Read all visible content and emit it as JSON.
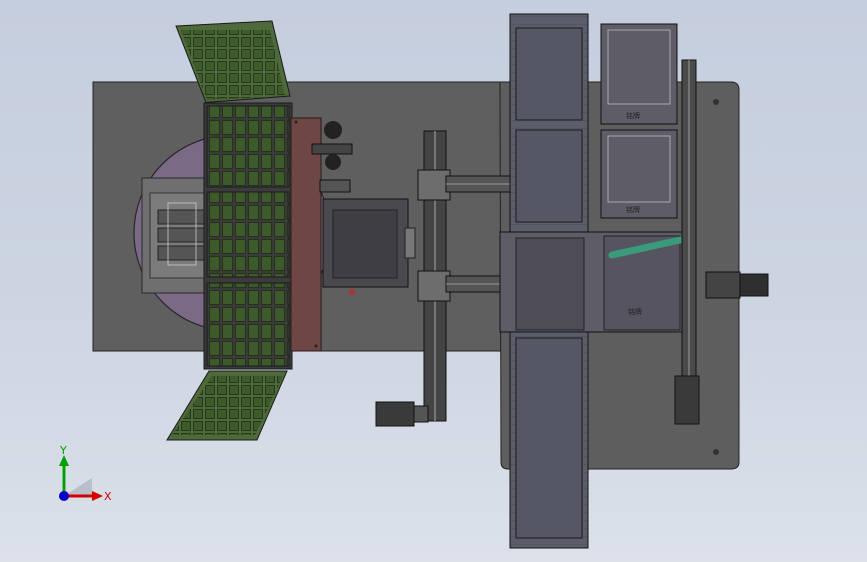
{
  "view": {
    "triad": {
      "x_label": "X",
      "y_label": "Y"
    },
    "plate_labels": [
      "铭牌",
      "铭牌",
      "铭牌"
    ]
  },
  "colors": {
    "background_top": "#c5cede",
    "background_bottom": "#dce1ea",
    "base_plate": "#5d5d5d",
    "tray_green": "#4f6a3a",
    "tray_cell": "#3e5a2c",
    "turntable": "#7a6a86",
    "conveyor": "#5a5d68",
    "axis_x": "#d40000",
    "axis_y": "#00a000",
    "axis_z": "#0000c8"
  }
}
